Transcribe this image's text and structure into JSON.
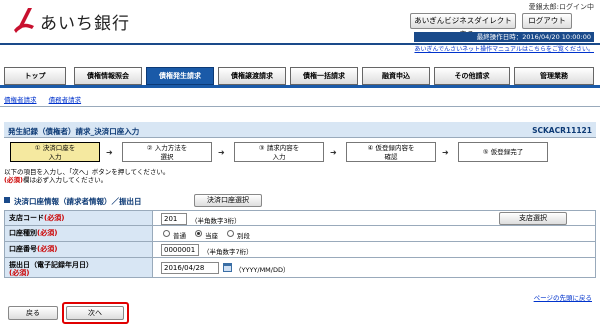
{
  "header": {
    "bank_name": "あいち銀行",
    "user_line": "愛銀太郎:ログイン中",
    "direct_button": "あいぎんビジネスダイレクトへ戻る",
    "logout_button": "ログアウト",
    "last_operation": "最終操作日時：2016/04/20 10:00:00",
    "manual_link": "あいぎんでんさいネット操作マニュアルはこちらをご覧ください。"
  },
  "tabs": [
    {
      "label": "トップ",
      "active": false
    },
    {
      "label": "債権情報照会",
      "active": false
    },
    {
      "label": "債権発生請求",
      "active": true
    },
    {
      "label": "債権譲渡請求",
      "active": false
    },
    {
      "label": "債権一括請求",
      "active": false
    },
    {
      "label": "融資申込",
      "active": false
    },
    {
      "label": "その他請求",
      "active": false
    },
    {
      "label": "管理業務",
      "active": false
    }
  ],
  "subnav": [
    "債権者請求",
    "債務者請求"
  ],
  "page": {
    "title": "発生記録（債権者）請求_決済口座入力",
    "screen_id": "SCKACR11121"
  },
  "steps": [
    {
      "label": "① 決済口座を\n入力",
      "current": true
    },
    {
      "label": "② 入力方法を\n選択",
      "current": false
    },
    {
      "label": "③ 請求内容を\n入力",
      "current": false
    },
    {
      "label": "④ 仮登録内容を\n確認",
      "current": false
    },
    {
      "label": "⑤ 仮登録完了",
      "current": false
    }
  ],
  "instructions": {
    "line1": "以下の項目を入力し、「次へ」ボタンを押してください。",
    "required_tag": "(必須)",
    "line2": "欄は必ず入力してください。"
  },
  "section": {
    "title": "決済口座情報（請求者情報）／振出日",
    "account_select_button": "決済口座選択"
  },
  "form": {
    "branch_code": {
      "label": "支店コード",
      "required": "(必須)",
      "value": "201",
      "note": "（半角数字3桁）",
      "button": "支店選択"
    },
    "account_type": {
      "label": "口座種別",
      "required": "(必須)",
      "options": [
        "普通",
        "当座",
        "別段"
      ],
      "selected": "当座"
    },
    "account_number": {
      "label": "口座番号",
      "required": "(必須)",
      "value": "0000001",
      "note": "（半角数字7桁）"
    },
    "issue_date": {
      "label": "振出日（電子記録年月日）",
      "required": "(必須)",
      "value": "2016/04/28",
      "note": "（YYYY/MM/DD）"
    }
  },
  "top_link": "ページの先頭に戻る",
  "footer": {
    "back_button": "戻る",
    "next_button": "次へ"
  }
}
